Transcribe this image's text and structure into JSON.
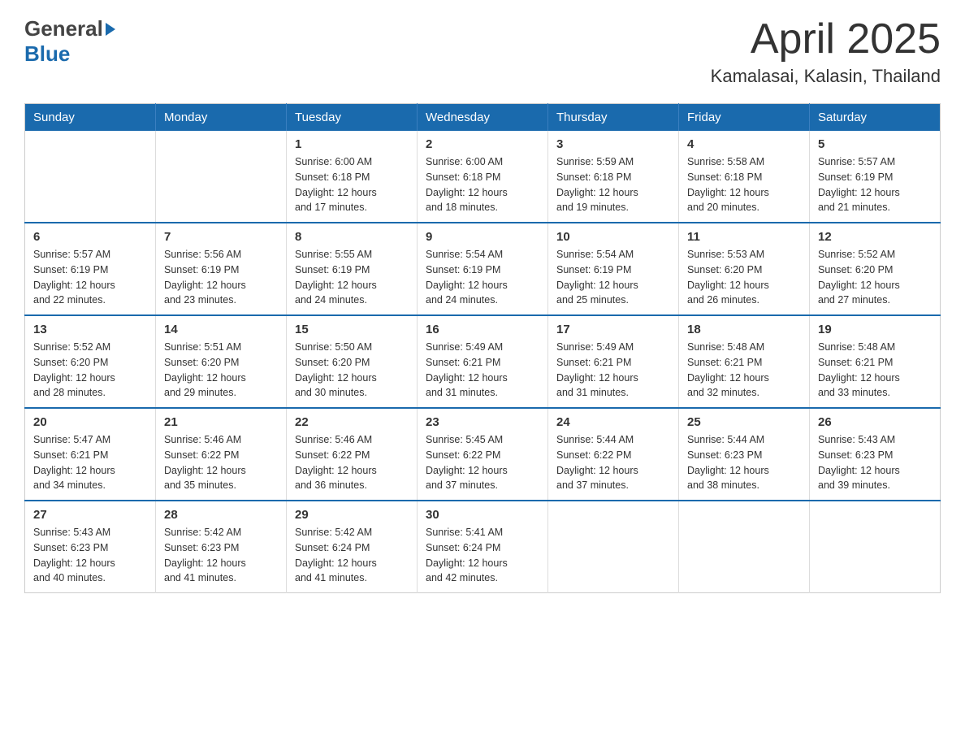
{
  "header": {
    "logo": {
      "line1": "General",
      "line2": "Blue"
    },
    "title": "April 2025",
    "location": "Kamalasai, Kalasin, Thailand"
  },
  "calendar": {
    "weekdays": [
      "Sunday",
      "Monday",
      "Tuesday",
      "Wednesday",
      "Thursday",
      "Friday",
      "Saturday"
    ],
    "weeks": [
      [
        {
          "day": "",
          "info": ""
        },
        {
          "day": "",
          "info": ""
        },
        {
          "day": "1",
          "info": "Sunrise: 6:00 AM\nSunset: 6:18 PM\nDaylight: 12 hours\nand 17 minutes."
        },
        {
          "day": "2",
          "info": "Sunrise: 6:00 AM\nSunset: 6:18 PM\nDaylight: 12 hours\nand 18 minutes."
        },
        {
          "day": "3",
          "info": "Sunrise: 5:59 AM\nSunset: 6:18 PM\nDaylight: 12 hours\nand 19 minutes."
        },
        {
          "day": "4",
          "info": "Sunrise: 5:58 AM\nSunset: 6:18 PM\nDaylight: 12 hours\nand 20 minutes."
        },
        {
          "day": "5",
          "info": "Sunrise: 5:57 AM\nSunset: 6:19 PM\nDaylight: 12 hours\nand 21 minutes."
        }
      ],
      [
        {
          "day": "6",
          "info": "Sunrise: 5:57 AM\nSunset: 6:19 PM\nDaylight: 12 hours\nand 22 minutes."
        },
        {
          "day": "7",
          "info": "Sunrise: 5:56 AM\nSunset: 6:19 PM\nDaylight: 12 hours\nand 23 minutes."
        },
        {
          "day": "8",
          "info": "Sunrise: 5:55 AM\nSunset: 6:19 PM\nDaylight: 12 hours\nand 24 minutes."
        },
        {
          "day": "9",
          "info": "Sunrise: 5:54 AM\nSunset: 6:19 PM\nDaylight: 12 hours\nand 24 minutes."
        },
        {
          "day": "10",
          "info": "Sunrise: 5:54 AM\nSunset: 6:19 PM\nDaylight: 12 hours\nand 25 minutes."
        },
        {
          "day": "11",
          "info": "Sunrise: 5:53 AM\nSunset: 6:20 PM\nDaylight: 12 hours\nand 26 minutes."
        },
        {
          "day": "12",
          "info": "Sunrise: 5:52 AM\nSunset: 6:20 PM\nDaylight: 12 hours\nand 27 minutes."
        }
      ],
      [
        {
          "day": "13",
          "info": "Sunrise: 5:52 AM\nSunset: 6:20 PM\nDaylight: 12 hours\nand 28 minutes."
        },
        {
          "day": "14",
          "info": "Sunrise: 5:51 AM\nSunset: 6:20 PM\nDaylight: 12 hours\nand 29 minutes."
        },
        {
          "day": "15",
          "info": "Sunrise: 5:50 AM\nSunset: 6:20 PM\nDaylight: 12 hours\nand 30 minutes."
        },
        {
          "day": "16",
          "info": "Sunrise: 5:49 AM\nSunset: 6:21 PM\nDaylight: 12 hours\nand 31 minutes."
        },
        {
          "day": "17",
          "info": "Sunrise: 5:49 AM\nSunset: 6:21 PM\nDaylight: 12 hours\nand 31 minutes."
        },
        {
          "day": "18",
          "info": "Sunrise: 5:48 AM\nSunset: 6:21 PM\nDaylight: 12 hours\nand 32 minutes."
        },
        {
          "day": "19",
          "info": "Sunrise: 5:48 AM\nSunset: 6:21 PM\nDaylight: 12 hours\nand 33 minutes."
        }
      ],
      [
        {
          "day": "20",
          "info": "Sunrise: 5:47 AM\nSunset: 6:21 PM\nDaylight: 12 hours\nand 34 minutes."
        },
        {
          "day": "21",
          "info": "Sunrise: 5:46 AM\nSunset: 6:22 PM\nDaylight: 12 hours\nand 35 minutes."
        },
        {
          "day": "22",
          "info": "Sunrise: 5:46 AM\nSunset: 6:22 PM\nDaylight: 12 hours\nand 36 minutes."
        },
        {
          "day": "23",
          "info": "Sunrise: 5:45 AM\nSunset: 6:22 PM\nDaylight: 12 hours\nand 37 minutes."
        },
        {
          "day": "24",
          "info": "Sunrise: 5:44 AM\nSunset: 6:22 PM\nDaylight: 12 hours\nand 37 minutes."
        },
        {
          "day": "25",
          "info": "Sunrise: 5:44 AM\nSunset: 6:23 PM\nDaylight: 12 hours\nand 38 minutes."
        },
        {
          "day": "26",
          "info": "Sunrise: 5:43 AM\nSunset: 6:23 PM\nDaylight: 12 hours\nand 39 minutes."
        }
      ],
      [
        {
          "day": "27",
          "info": "Sunrise: 5:43 AM\nSunset: 6:23 PM\nDaylight: 12 hours\nand 40 minutes."
        },
        {
          "day": "28",
          "info": "Sunrise: 5:42 AM\nSunset: 6:23 PM\nDaylight: 12 hours\nand 41 minutes."
        },
        {
          "day": "29",
          "info": "Sunrise: 5:42 AM\nSunset: 6:24 PM\nDaylight: 12 hours\nand 41 minutes."
        },
        {
          "day": "30",
          "info": "Sunrise: 5:41 AM\nSunset: 6:24 PM\nDaylight: 12 hours\nand 42 minutes."
        },
        {
          "day": "",
          "info": ""
        },
        {
          "day": "",
          "info": ""
        },
        {
          "day": "",
          "info": ""
        }
      ]
    ]
  }
}
